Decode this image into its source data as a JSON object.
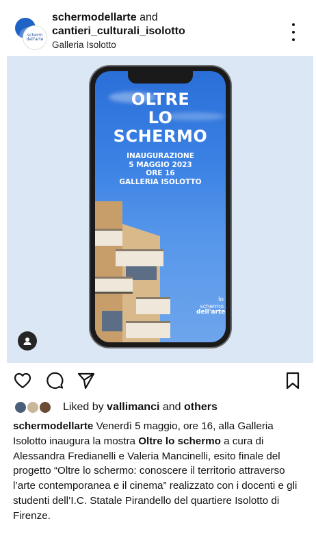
{
  "header": {
    "user1": "schermodellarte",
    "and_word": "and",
    "user2": "cantieri_culturali_isolotto",
    "location": "Galleria Isolotto",
    "avatar_logo_text": "scherm dell'arte"
  },
  "poster": {
    "title_lines": [
      "OLTRE",
      "LO",
      "SCHERMO"
    ],
    "info_lines": [
      "INAUGURAZIONE",
      "5 MAGGIO 2023",
      "ORE 16",
      "GALLERIA ISOLOTTO"
    ],
    "logo_lines": [
      "lo",
      "schermo",
      "dell'arte"
    ]
  },
  "icons": {
    "like": "heart-icon",
    "comment": "comment-icon",
    "share": "send-icon",
    "save": "bookmark-icon",
    "more": "more-vertical-icon",
    "tag": "user-tag-icon"
  },
  "likes": {
    "prefix": "Liked by ",
    "user": "vallimanci",
    "middle": " and ",
    "others": "others"
  },
  "caption": {
    "author": "schermodellarte",
    "part1": " Venerdì 5 maggio, ore 16, alla Galleria Isolotto inaugura la mostra ",
    "bold": "Oltre lo schermo",
    "part2": " a cura di Alessandra Fredianelli e Valeria Mancinelli, esito finale del progetto “Oltre lo schermo: conoscere il territorio attraverso l’arte contemporanea e il cinema” realizzato con i docenti e gli studenti dell’I.C. Statale Pirandello del quartiere Isolotto di Firenze."
  }
}
